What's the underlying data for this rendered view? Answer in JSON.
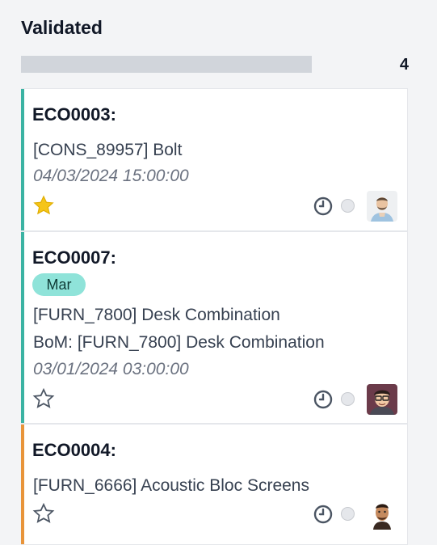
{
  "column": {
    "title": "Validated",
    "count": "4",
    "progress_fraction": 0.0
  },
  "colors": {
    "teal_stripe": "#3bb3a3",
    "orange_stripe": "#e8943a",
    "tag_bg": "#8fe3d9",
    "star_fill": "#f5c518"
  },
  "cards": [
    {
      "reference": "ECO0003:",
      "product": "[CONS_89957] Bolt",
      "date": "04/03/2024 15:00:00",
      "starred": true,
      "status_icon": "clock-icon",
      "avatar_icon": "man-with-beard-avatar"
    },
    {
      "reference": "ECO0007:",
      "tag": "Mar",
      "product": "[FURN_7800] Desk Combination",
      "bom": "BoM: [FURN_7800] Desk Combination",
      "date": "03/01/2024 03:00:00",
      "starred": false,
      "status_icon": "clock-icon",
      "avatar_icon": "man-with-glasses-avatar"
    },
    {
      "reference": "ECO0004:",
      "product": "[FURN_6666] Acoustic Bloc Screens",
      "starred": false,
      "status_icon": "clock-icon",
      "avatar_icon": "man-cartoon-avatar"
    }
  ]
}
